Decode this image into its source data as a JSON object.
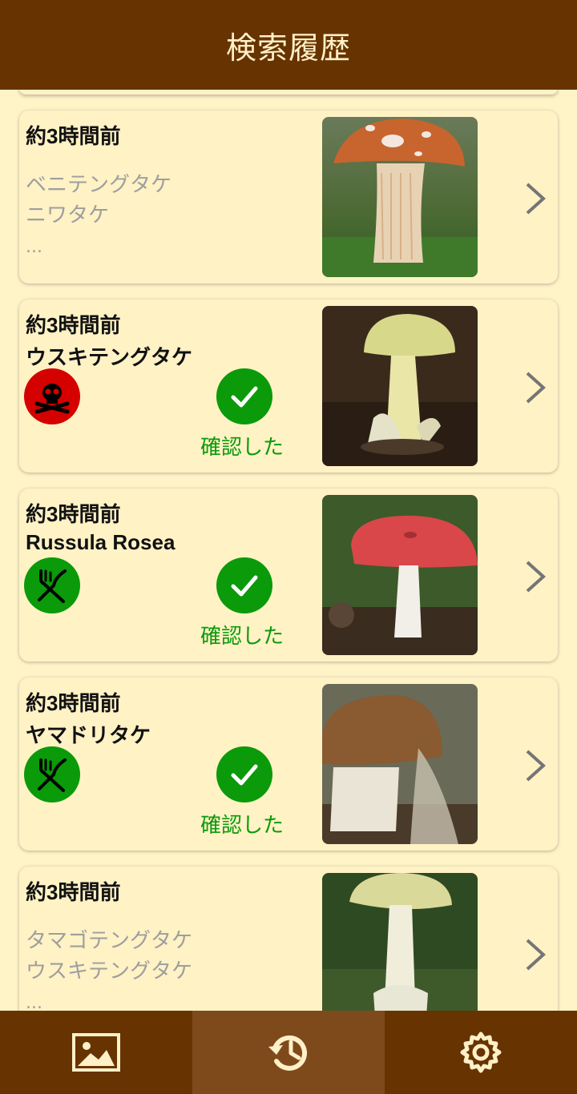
{
  "appbar": {
    "title": "検索履歴"
  },
  "history": [
    {
      "time": "約3時間前",
      "candidates": [
        "ベニテングタケ",
        "ニワタケ"
      ],
      "more": "..."
    },
    {
      "time": "約3時間前",
      "name": "ウスキテングタケ",
      "toxicity_icon": "poison-skull-icon",
      "confirmed_label": "確認した"
    },
    {
      "time": "約3時間前",
      "name": "Russula Rosea",
      "toxicity_icon": "edible-fork-knife-icon",
      "confirmed_label": "確認した"
    },
    {
      "time": "約3時間前",
      "name": "ヤマドリタケ",
      "toxicity_icon": "edible-fork-knife-icon",
      "confirmed_label": "確認した"
    },
    {
      "time": "約3時間前",
      "candidates": [
        "タマゴテングタケ",
        "ウスキテングタケ"
      ],
      "more": "..."
    }
  ],
  "bottom_nav": {
    "items": [
      "image-gallery-icon",
      "history-icon",
      "settings-icon"
    ],
    "active": "history-icon"
  },
  "colors": {
    "primary": "#673300",
    "background": "#FFF3C8",
    "poison": "#D50000",
    "edible": "#0A9A0A"
  }
}
